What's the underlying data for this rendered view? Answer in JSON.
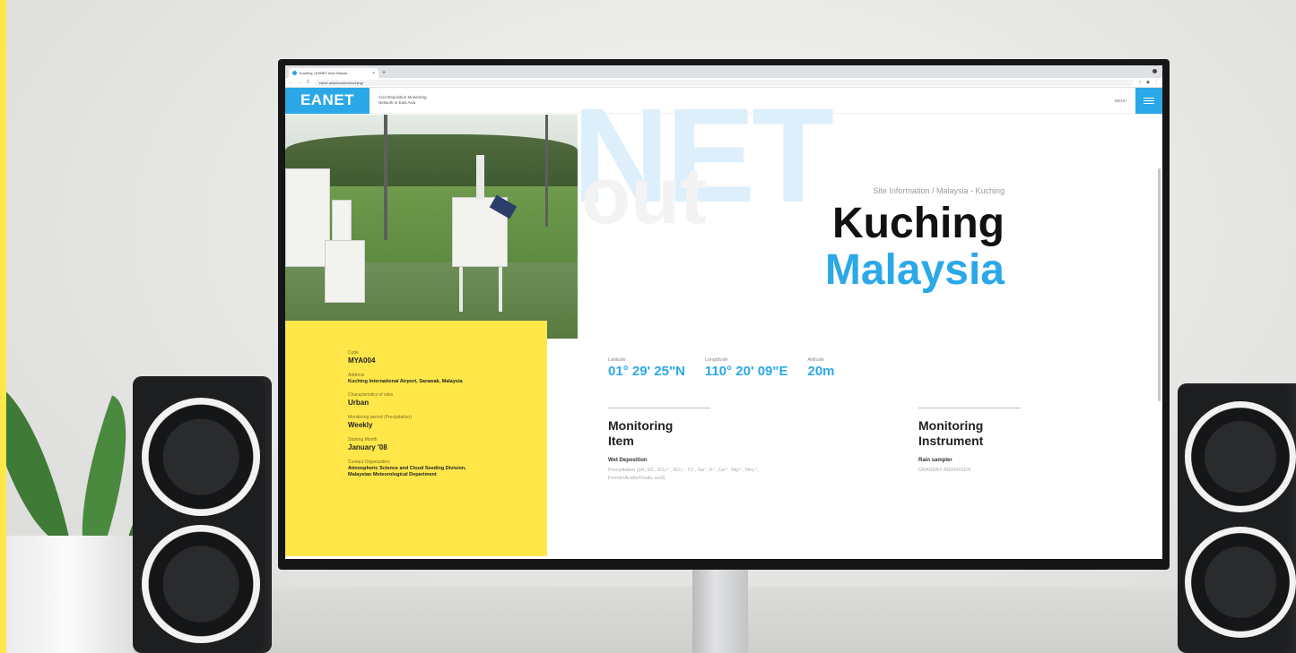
{
  "browser": {
    "tab_title": "Kuching | EANET Acid Deposi",
    "tab_close": "×",
    "new_tab": "+",
    "url": "eanet.asia/location/kuching/",
    "back": "←",
    "forward": "→",
    "reload": "C"
  },
  "header": {
    "logo": "EANET",
    "tagline_line1": "Acid Deposition Monitoring",
    "tagline_line2": "Network in East Asia",
    "menu_label": "MENU"
  },
  "hero": {
    "watermark": "NET",
    "watermark2": "out",
    "breadcrumb": "Site Information / Malaysia - Kuching",
    "city": "Kuching",
    "country": "Malaysia"
  },
  "info": {
    "code_label": "Code",
    "code": "MYA004",
    "address_label": "Address",
    "address": "Kuching International Airport, Sarawak, Malaysia",
    "characteristics_label": "Characteristics of sites",
    "characteristics": "Urban",
    "period_label": "Monitoring period (Precipitation)",
    "period": "Weekly",
    "start_label": "Starting Month",
    "start": "January '08",
    "contact_label": "Contact Organization",
    "contact_line1": "Atmospheric Science and Cloud Seeding Division,",
    "contact_line2": "Malaysian Meteorological Department"
  },
  "coords": {
    "latitude_label": "Latitude",
    "latitude": "01° 29' 25\"N",
    "longitude_label": "Longtitude",
    "longitude": "110° 20' 09\"E",
    "altitude_label": "Altitude",
    "altitude": "20m"
  },
  "monitoring_item": {
    "title_line1": "Monitoring",
    "title_line2": "Item",
    "subtitle": "Wet Deposition",
    "text_line1": "Precipitation (pH, EC, SO₄²⁻, NO₃⁻, Cl⁻, Na⁺, K⁺, Ca²⁺, Mg²⁺, NH₄⁺,",
    "text_line2": "Formic/Acetic/Oxalic acid)"
  },
  "monitoring_instrument": {
    "title_line1": "Monitoring",
    "title_line2": "Instrument",
    "subtitle": "Rain sampler",
    "text": "GRASEBY ANDERSEN"
  },
  "colors": {
    "accent": "#2ba8e8",
    "panel": "#ffe74a",
    "text_dark": "#111111"
  }
}
